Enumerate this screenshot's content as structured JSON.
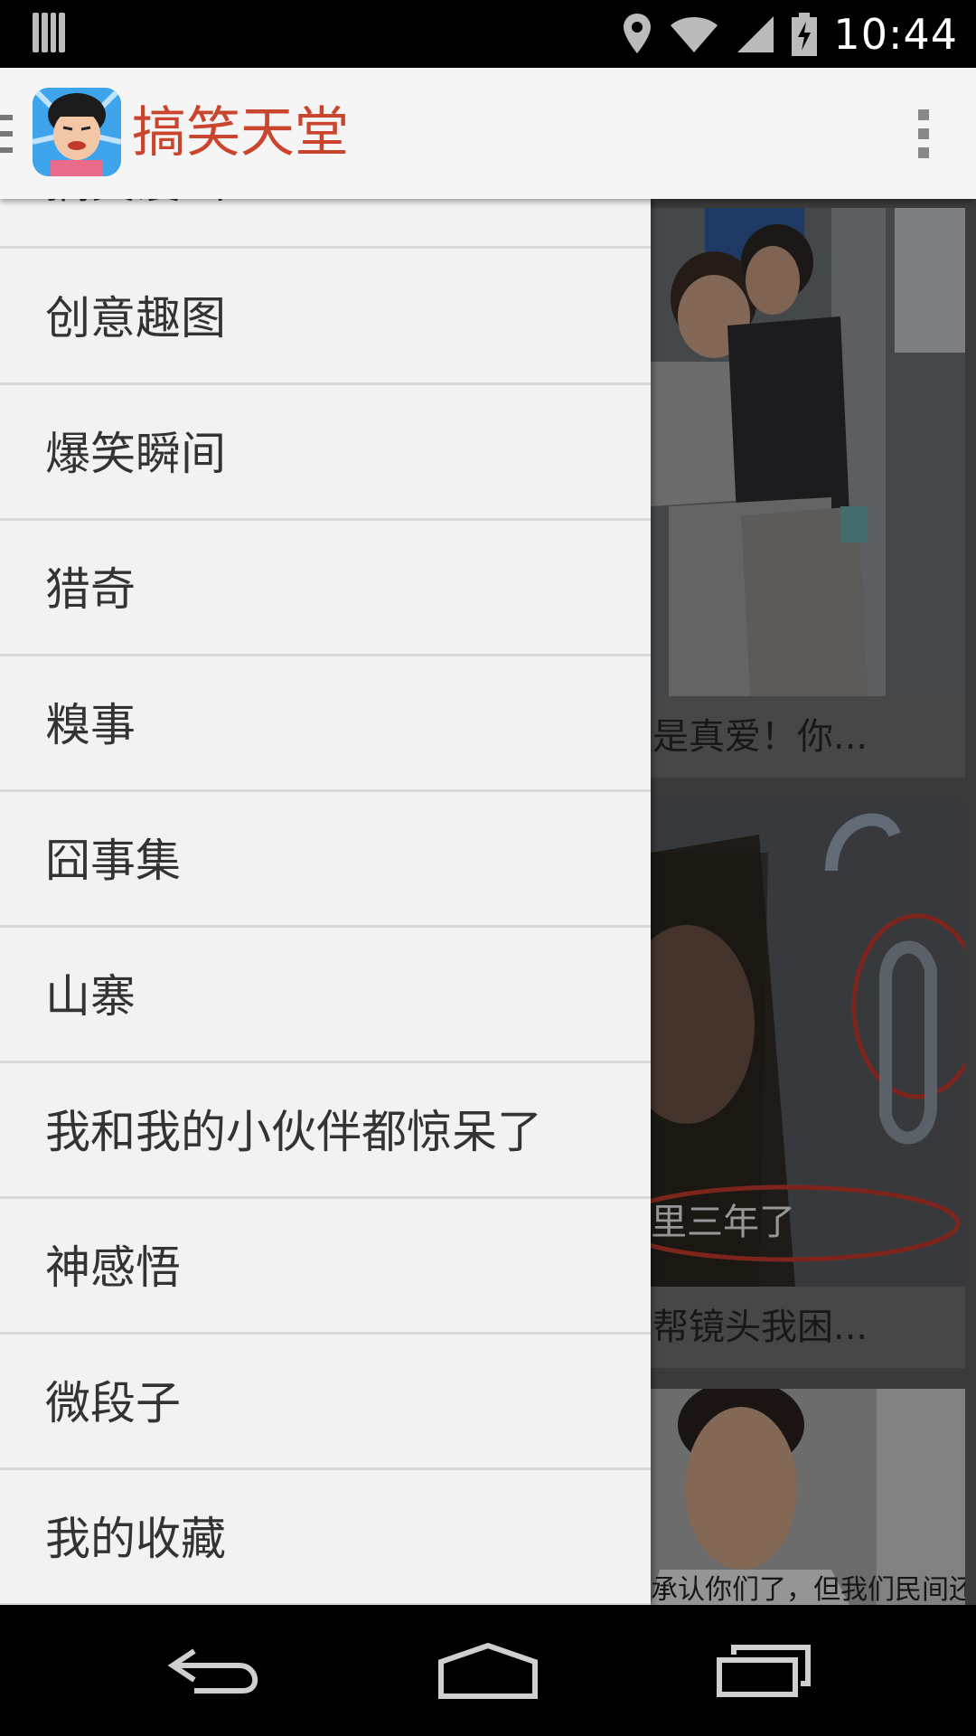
{
  "status_bar": {
    "time": "10:44",
    "icons": [
      "signal-bars-icon",
      "location-icon",
      "wifi-icon",
      "cell-signal-icon",
      "battery-charging-icon"
    ]
  },
  "action_bar": {
    "title": "搞笑天堂",
    "title_color": "#c9452d"
  },
  "drawer": {
    "partial_item": "搞笑漫画",
    "items": [
      {
        "label": "创意趣图"
      },
      {
        "label": "爆笑瞬间"
      },
      {
        "label": "猎奇"
      },
      {
        "label": "糗事"
      },
      {
        "label": "囧事集"
      },
      {
        "label": "山寨"
      },
      {
        "label": "我和我的小伙伴都惊呆了"
      },
      {
        "label": "神感悟"
      },
      {
        "label": "微段子"
      },
      {
        "label": "我的收藏"
      }
    ]
  },
  "feed": {
    "cards": [
      {
        "caption": "是真爱！你...",
        "photo_text": ""
      },
      {
        "caption": "帮镜头我困...",
        "photo_text": "里三年了"
      },
      {
        "caption": "",
        "photo_text": "承认你们了，但我们民间还"
      }
    ]
  },
  "nav_bar": {
    "buttons": [
      "back-icon",
      "home-icon",
      "recent-apps-icon"
    ]
  }
}
